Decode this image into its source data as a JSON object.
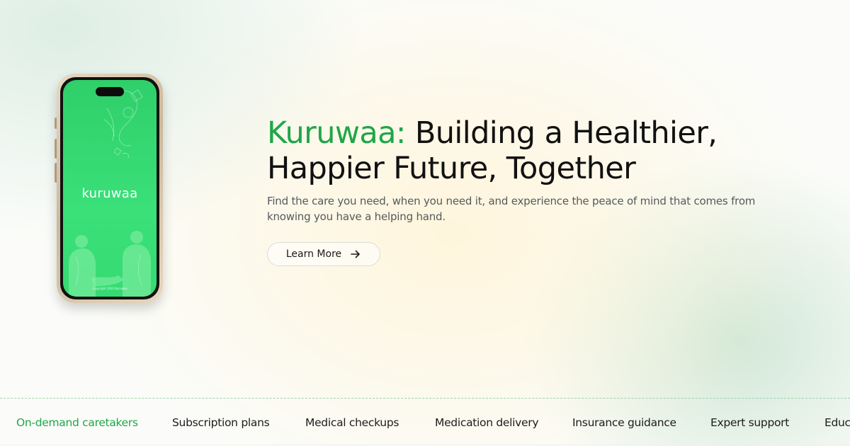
{
  "hero": {
    "brand": "Kuruwaa:",
    "title_line1_rest": " Building a Healthier,",
    "title_line2": "Happier Future, Together",
    "description": "Find the care you need, when you need it, and experience the peace of mind that comes from knowing you have a helping hand.",
    "cta_label": "Learn More",
    "cta_icon": "arrow-right-icon"
  },
  "phone": {
    "logo_text": "kuruwaa",
    "copyright": "Copyright 2024 Kuruwaa"
  },
  "services": {
    "items": [
      {
        "label": "On-demand caretakers",
        "active": true
      },
      {
        "label": "Subscription plans"
      },
      {
        "label": "Medical checkups"
      },
      {
        "label": "Medication delivery"
      },
      {
        "label": "Insurance guidance"
      },
      {
        "label": "Expert support"
      },
      {
        "label": "Educ"
      }
    ]
  },
  "colors": {
    "brand_green": "#1fa64a",
    "phone_screen_green": "#34d46f",
    "text_dark": "#111111",
    "text_muted": "#555a5e"
  }
}
